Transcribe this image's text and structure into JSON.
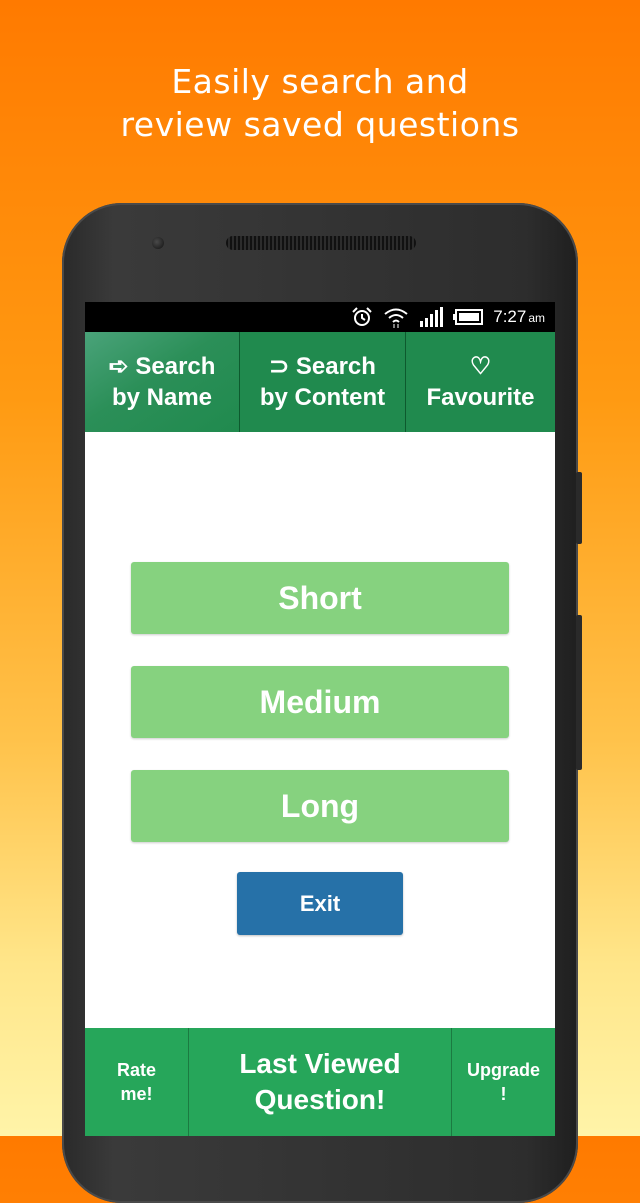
{
  "headline": {
    "line1": "Easily search and",
    "line2": "review saved questions"
  },
  "status_bar": {
    "time": "7:27",
    "ampm": "am",
    "icons": [
      "alarm-icon",
      "wifi-icon",
      "signal-icon",
      "battery-icon"
    ]
  },
  "top_nav": {
    "search_name": {
      "icon": "arrow-right-outline-icon",
      "glyph": "➪",
      "line1": "Search",
      "line2": "by Name"
    },
    "search_content": {
      "icon": "return-arrow-icon",
      "glyph": "⊃",
      "line1": "Search",
      "line2": "by Content"
    },
    "favourite": {
      "icon": "heart-outline-icon",
      "glyph": "♡",
      "line1": "Favourite"
    }
  },
  "main": {
    "short_label": "Short",
    "medium_label": "Medium",
    "long_label": "Long",
    "exit_label": "Exit"
  },
  "bottom_nav": {
    "rate": {
      "line1": "Rate",
      "line2": "me!"
    },
    "last_viewed": {
      "line1": "Last Viewed",
      "line2": "Question!"
    },
    "upgrade": {
      "line1": "Upgrade",
      "line2": "!"
    }
  },
  "colors": {
    "nav_green": "#208a4e",
    "bottom_green": "#26a65a",
    "button_green": "#86d27f",
    "exit_blue": "#2671a8",
    "bg_top": "#ff7a00",
    "bg_bottom": "#fff4a8"
  }
}
